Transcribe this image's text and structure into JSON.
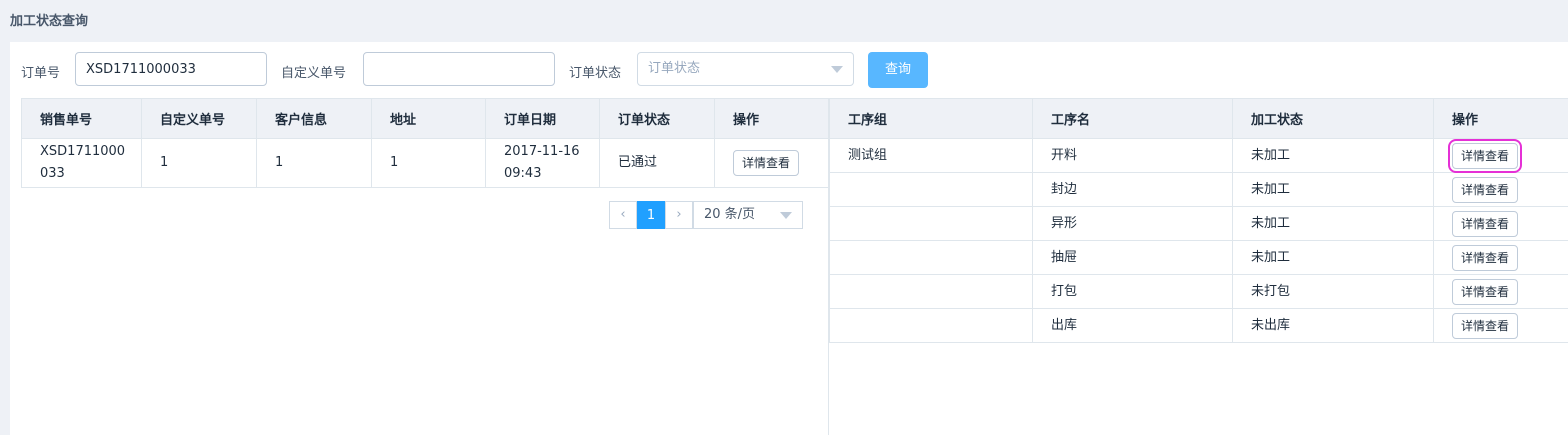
{
  "page": {
    "title": "加工状态查询"
  },
  "search": {
    "order_no_label": "订单号",
    "order_no_value": "XSD1711000033",
    "custom_no_label": "自定义单号",
    "custom_no_value": "",
    "status_label": "订单状态",
    "status_placeholder": "订单状态",
    "query_button": "查询"
  },
  "orders": {
    "headers": [
      "销售单号",
      "自定义单号",
      "客户信息",
      "地址",
      "订单日期",
      "订单状态",
      "操作"
    ],
    "rows": [
      {
        "sales_no_line1": "XSD1711000",
        "sales_no_line2": "033",
        "custom_no": "1",
        "customer": "1",
        "address": "1",
        "date_line1": "2017-11-16",
        "date_line2": "09:43",
        "status": "已通过",
        "action": "详情查看"
      }
    ]
  },
  "pagination": {
    "prev_icon": "chevron-left-icon",
    "next_icon": "chevron-right-icon",
    "current_page": "1",
    "page_size": "20 条/页"
  },
  "processes": {
    "headers": [
      "工序组",
      "工序名",
      "加工状态",
      "操作"
    ],
    "rows": [
      {
        "group": "测试组",
        "name": "开料",
        "state": "未加工",
        "action": "详情查看"
      },
      {
        "group": "",
        "name": "封边",
        "state": "未加工",
        "action": "详情查看"
      },
      {
        "group": "",
        "name": "异形",
        "state": "未加工",
        "action": "详情查看"
      },
      {
        "group": "",
        "name": "抽屉",
        "state": "未加工",
        "action": "详情查看"
      },
      {
        "group": "",
        "name": "打包",
        "state": "未打包",
        "action": "详情查看"
      },
      {
        "group": "",
        "name": "出库",
        "state": "未出库",
        "action": "详情查看"
      }
    ]
  },
  "colors": {
    "primary": "#58b7ff",
    "page_active": "#20a0ff",
    "highlight": "#e530d6"
  }
}
